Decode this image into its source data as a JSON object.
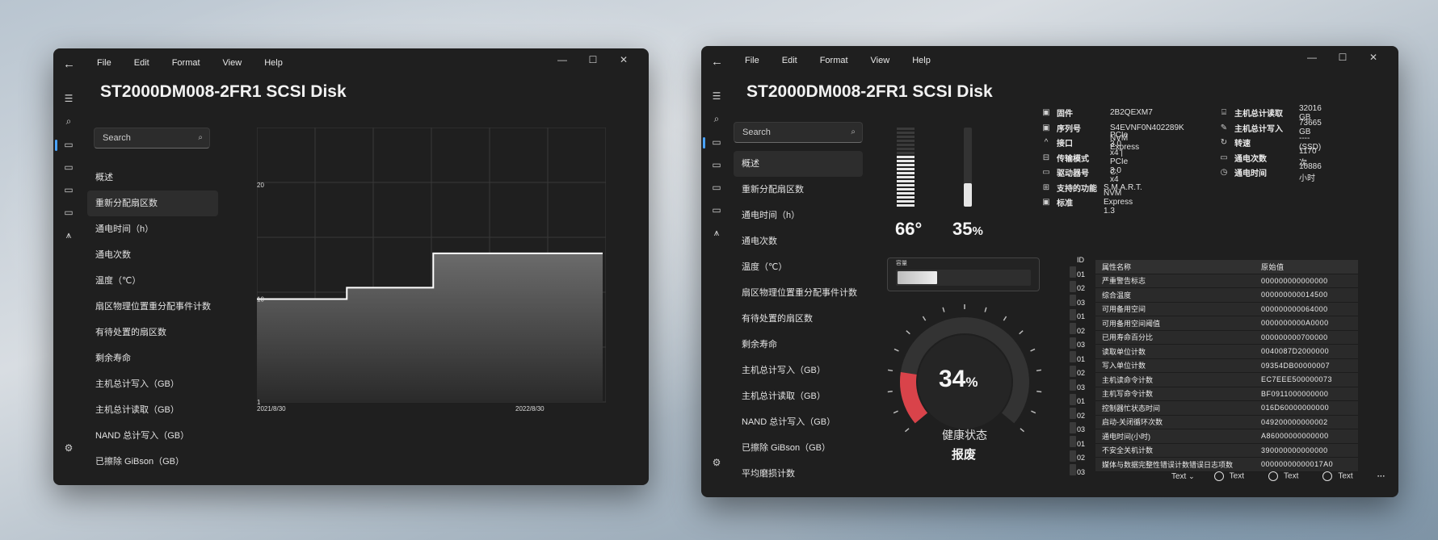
{
  "window1": {
    "menu": [
      "File",
      "Edit",
      "Format",
      "View",
      "Help"
    ],
    "title": "ST2000DM008-2FR1 SCSI Disk",
    "search_placeholder": "Search",
    "nav_items": [
      "概述",
      "重新分配扇区数",
      "通电时间（h）",
      "通电次数",
      "温度（℃）",
      "扇区物理位置重分配事件计数",
      "有待处置的扇区数",
      "剩余寿命",
      "主机总计写入（GB）",
      "主机总计读取（GB）",
      "NAND 总计写入（GB）",
      "已擦除 GiBson（GB）"
    ],
    "active_nav_index": 1,
    "chart_data": {
      "type": "area",
      "title": "",
      "xlabel": "",
      "ylabel": "",
      "ylim": [
        1,
        25
      ],
      "y_ticks": [
        "20",
        "10",
        "1"
      ],
      "x_tick_labels": [
        "2021/8/30",
        "2022/8/30"
      ],
      "points": [
        {
          "x": 0.0,
          "y": 10
        },
        {
          "x": 0.26,
          "y": 10
        },
        {
          "x": 0.26,
          "y": 11
        },
        {
          "x": 0.51,
          "y": 11
        },
        {
          "x": 0.51,
          "y": 14
        },
        {
          "x": 1.0,
          "y": 14
        }
      ],
      "grid": true
    }
  },
  "window2": {
    "menu": [
      "File",
      "Edit",
      "Format",
      "View",
      "Help"
    ],
    "title": "ST2000DM008-2FR1 SCSI Disk",
    "search_placeholder": "Search",
    "nav_items": [
      "概述",
      "重新分配扇区数",
      "通电时间（h）",
      "通电次数",
      "温度（℃）",
      "扇区物理位置重分配事件计数",
      "有待处置的扇区数",
      "剩余寿命",
      "主机总计写入（GB）",
      "主机总计读取（GB）",
      "NAND 总计写入（GB）",
      "已擦除 GiBson（GB）",
      "平均磨损计数"
    ],
    "active_nav_index": 0,
    "temperature": {
      "value": "66°",
      "level": 0.66
    },
    "usage": {
      "value": "35",
      "unit": "%",
      "level": 0.35
    },
    "capacity": {
      "label": "容量",
      "level": 0.3
    },
    "health": {
      "percent": "34",
      "unit": "%",
      "label": "健康状态",
      "status": "报废",
      "level": 0.34
    },
    "info_left": [
      {
        "icon": "chip-icon",
        "label": "固件",
        "value": "2B2QEXM7"
      },
      {
        "icon": "chip-icon",
        "label": "序列号",
        "value": "S4EVNF0N402289K"
      },
      {
        "icon": "caret-icon",
        "label": "接口",
        "value": "NVM Express"
      },
      {
        "icon": "bus-icon",
        "label": "传输模式",
        "value": "PCIe 3.0 x4 | PCIe 3.0 x4"
      },
      {
        "icon": "drive-icon",
        "label": "驱动器号",
        "value": "C:"
      },
      {
        "icon": "grid-icon",
        "label": "支持的功能",
        "value": "S.M.A.R.T."
      },
      {
        "icon": "chip-icon",
        "label": "标准",
        "value": "NVM Express 1.3"
      }
    ],
    "info_right": [
      {
        "icon": "read-icon",
        "label": "主机总计读取",
        "value": "32016 GB"
      },
      {
        "icon": "pen-icon",
        "label": "主机总计写入",
        "value": "73665 GB"
      },
      {
        "icon": "rotate-icon",
        "label": "转速",
        "value": "---- (SSD)"
      },
      {
        "icon": "drive-icon",
        "label": "通电次数",
        "value": "1170 次"
      },
      {
        "icon": "clock-icon",
        "label": "通电时间",
        "value": "10886 小时"
      }
    ],
    "smart": {
      "id_header": "ID",
      "ids": [
        "01",
        "02",
        "03",
        "01",
        "02",
        "03",
        "01",
        "02",
        "03",
        "01",
        "02",
        "03",
        "01",
        "02",
        "03"
      ],
      "headers": [
        "属性名称",
        "原始值"
      ],
      "rows": [
        [
          "严重警告标志",
          "000000000000000"
        ],
        [
          "综合温度",
          "000000000014500"
        ],
        [
          "可用备用空间",
          "000000000064000"
        ],
        [
          "可用备用空间阈值",
          "0000000000A0000"
        ],
        [
          "已用寿命百分比",
          "000000000700000"
        ],
        [
          "读取单位计数",
          "0040087D2000000"
        ],
        [
          "写入单位计数",
          "09354DB00000007"
        ],
        [
          "主机读命令计数",
          "EC7EEE500000073"
        ],
        [
          "主机写命令计数",
          "BF0911000000000"
        ],
        [
          "控制器忙状态时间",
          "016D60000000000"
        ],
        [
          "启动-关闭循环次数",
          "049200000000002"
        ],
        [
          "通电时间(小时)",
          "A86000000000000"
        ],
        [
          "不安全关机计数",
          "390000000000000"
        ],
        [
          "媒体与数据完整性错误计数错误日志项数",
          "00000000000017A0"
        ]
      ]
    },
    "bottom": {
      "dropdown": "Text",
      "options": [
        "Text",
        "Text",
        "Text"
      ],
      "more": "···"
    }
  }
}
